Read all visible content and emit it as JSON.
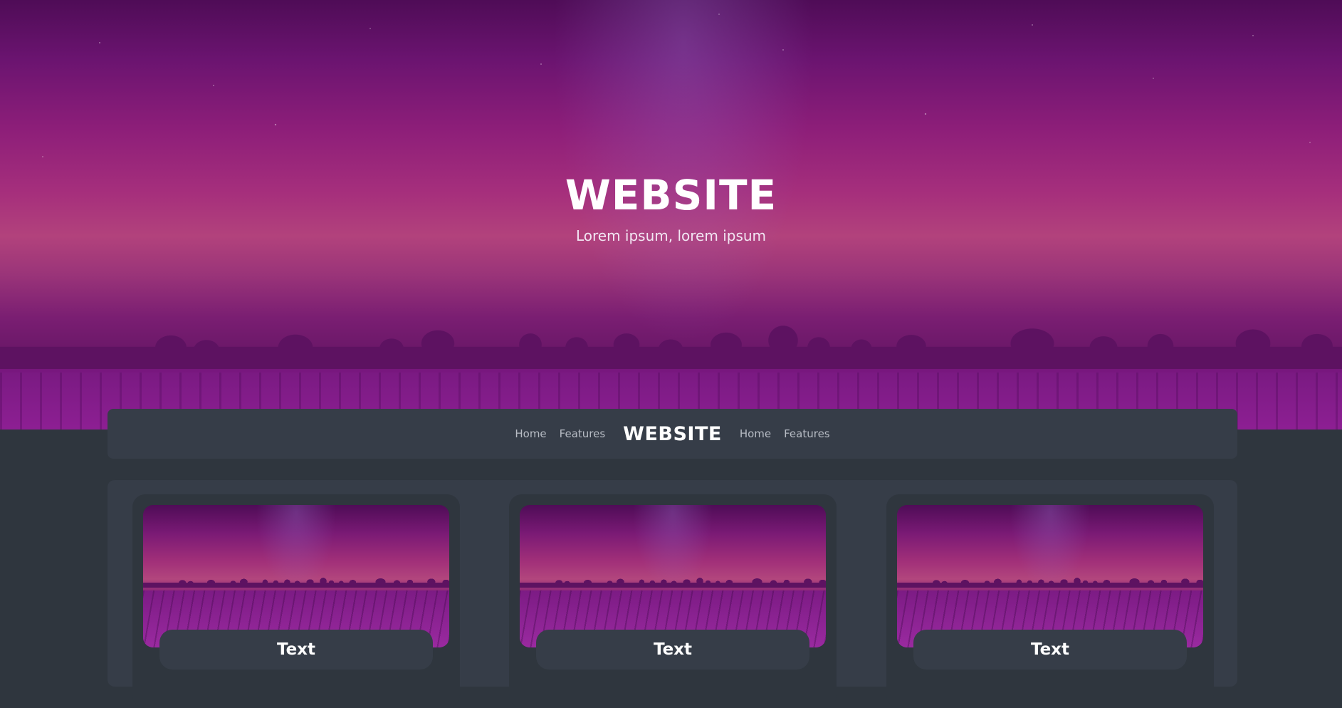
{
  "hero": {
    "title": "WEBSITE",
    "subtitle": "Lorem ipsum, lorem ipsum"
  },
  "navbar": {
    "left_links": [
      "Home",
      "Features"
    ],
    "brand": "WEBSITE",
    "right_links": [
      "Home",
      "Features"
    ]
  },
  "cards": [
    {
      "label": "Text"
    },
    {
      "label": "Text"
    },
    {
      "label": "Text"
    }
  ],
  "colors": {
    "page_background": "#2f363e",
    "panel_background": "#363d48",
    "hero_accent": "#a62f7c",
    "text_primary": "#ffffff",
    "text_muted": "#b7bcc4"
  }
}
